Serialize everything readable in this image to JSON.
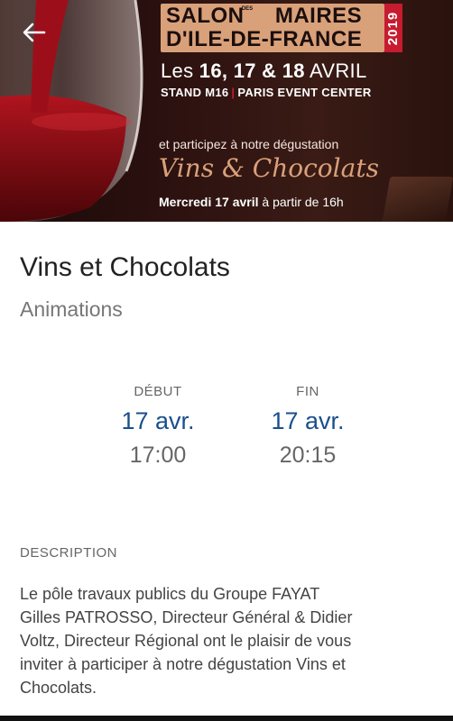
{
  "banner": {
    "salon_line1": "SALON",
    "salon_des": "DES",
    "salon_line1b": "MAIRES",
    "salon_line2": "D'ILE-DE-FRANCE",
    "year": "2019",
    "dates_prefix": "Les ",
    "dates_bold": "16, 17 & 18",
    "dates_suffix": " AVRIL",
    "stand": "STAND M16",
    "stand_sep": "|",
    "venue": "PARIS EVENT CENTER",
    "participez": "et participez à notre dégustation",
    "script_title": "Vins & Chocolats",
    "mercredi_bold": "Mercredi 17 avril",
    "mercredi_rest": " à partir de 16h"
  },
  "event": {
    "title": "Vins et Chocolats",
    "category": "Animations"
  },
  "schedule": {
    "start": {
      "label": "DÉBUT",
      "date": "17 avr.",
      "time": "17:00"
    },
    "end": {
      "label": "FIN",
      "date": "17 avr.",
      "time": "20:15"
    }
  },
  "description": {
    "label": "DESCRIPTION",
    "text": "Le pôle travaux publics du Groupe FAYAT\nGilles PATROSSO, Directeur Général & Didier\nVoltz, Directeur Régional ont le plaisir de vous\ninviter  à participer à notre dégustation Vins et\nChocolats."
  },
  "icons": {
    "back": "arrow-left-icon"
  },
  "colors": {
    "accent_blue": "#1a4f8c",
    "banner_gold": "#d9a17a",
    "badge_red": "#c71b2f"
  }
}
